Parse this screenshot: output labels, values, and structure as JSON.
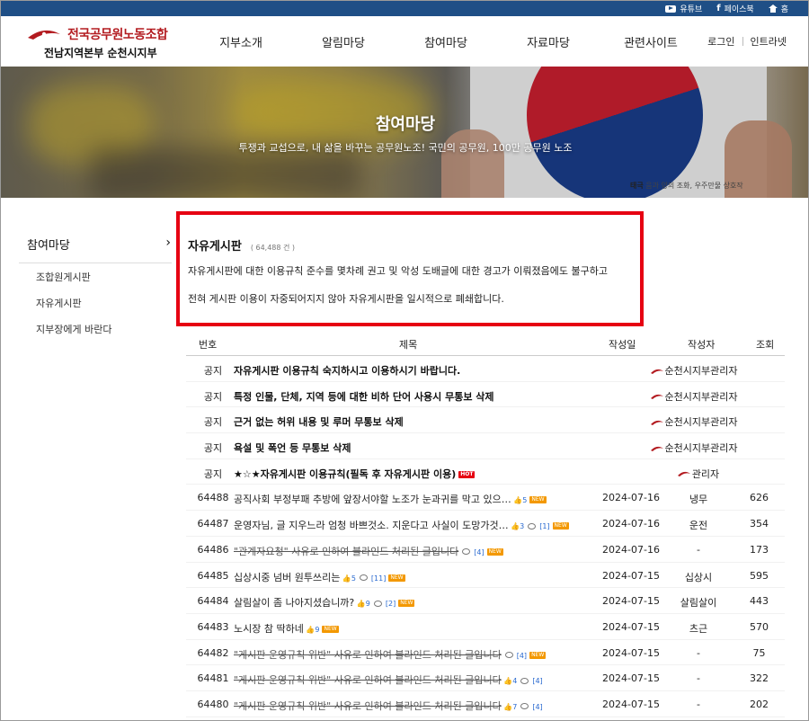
{
  "topbar": {
    "youtube": "유튜브",
    "facebook": "페이스북",
    "home": "홈"
  },
  "header": {
    "org_name": "전국공무원노동조합",
    "branch_name": "전남지역본부 순천시지부",
    "nav": [
      "지부소개",
      "알림마당",
      "참여마당",
      "자료마당",
      "관련사이트"
    ],
    "login": "로그인",
    "intranet": "인트라넷"
  },
  "hero": {
    "title": "참여마당",
    "subtitle": "투쟁과 교섭으로, 내 삶을 바꾸는 공무원노조! 국민의 공무원, 100만 공무원 노조",
    "caption_bold": "태극",
    "caption_rest": " 음과 양의 조화, 우주만물 상호작"
  },
  "sidebar": {
    "heading": "참여마당",
    "items": [
      "조합원게시판",
      "자유게시판",
      "지부장에게 바란다"
    ]
  },
  "notice": {
    "title": "자유게시판",
    "count": "( 64,488 건 )",
    "line1": "자유게시판에 대한 이용규칙 준수를 몇차례 권고 및 악성 도배글에 대한 경고가 이뤄졌음에도 불구하고",
    "line2": "전혀 게시판 이용이 자중되어지지 않아 자유게시판을 일시적으로 폐쇄합니다."
  },
  "board": {
    "headers": {
      "no": "번호",
      "title": "제목",
      "date": "작성일",
      "author": "작성자",
      "views": "조회"
    },
    "notices": [
      {
        "no": "공지",
        "title": "자유게시판 이용규칙 숙지하시고 이용하시기 바랍니다.",
        "author": "순천시지부관리자",
        "views": ""
      },
      {
        "no": "공지",
        "title": "특정 인물, 단체, 지역 등에 대한 비하 단어 사용시 무통보 삭제",
        "author": "순천시지부관리자",
        "views": ""
      },
      {
        "no": "공지",
        "title": "근거 없는 허위 내용 및 루머 무통보 삭제",
        "author": "순천시지부관리자",
        "views": ""
      },
      {
        "no": "공지",
        "title": "욕설 및 폭언 등 무통보 삭제",
        "author": "순천시지부관리자",
        "views": ""
      },
      {
        "no": "공지",
        "title": "★☆★자유게시판 이용규칙(필독 후 자유게시판 이용)",
        "author": "관리자",
        "hot": "HOT",
        "views": ""
      }
    ],
    "posts": [
      {
        "no": "64488",
        "title": "공직사회 부정부패 추방에 앞장서야할 노조가 눈과귀를 막고 있으…",
        "likes": "5",
        "comments": "",
        "new": "NEW",
        "date": "2024-07-16",
        "author": "냉무",
        "views": "626",
        "strike": false
      },
      {
        "no": "64487",
        "title": "운영자님, 글 지우느라 엄청 바쁘것소. 지운다고 사실이 도망가것…",
        "likes": "3",
        "comments": "[1]",
        "new": "NEW",
        "date": "2024-07-16",
        "author": "운전",
        "views": "354",
        "strike": false
      },
      {
        "no": "64486",
        "title": "\"관계자요청\" 사유로 인하여 블라인드 처리된 글입니다",
        "likes": "",
        "comments": "[4]",
        "new": "NEW",
        "date": "2024-07-16",
        "author": "-",
        "views": "173",
        "strike": true
      },
      {
        "no": "64485",
        "title": "십상시중 넘버 원투쓰리는",
        "likes": "5",
        "comments": "[11]",
        "new": "NEW",
        "date": "2024-07-15",
        "author": "십상시",
        "views": "595",
        "strike": false
      },
      {
        "no": "64484",
        "title": "살림살이 좀 나아지셨습니까?",
        "likes": "9",
        "comments": "[2]",
        "new": "NEW",
        "date": "2024-07-15",
        "author": "살림살이",
        "views": "443",
        "strike": false
      },
      {
        "no": "64483",
        "title": "노시장 참 딱하네",
        "likes": "9",
        "comments": "",
        "new": "NEW",
        "date": "2024-07-15",
        "author": "츠근",
        "views": "570",
        "strike": false
      },
      {
        "no": "64482",
        "title": "\"게시판 운영규칙 위반\" 사유로 인하여 블라인드 처리된 글입니다",
        "likes": "",
        "comments": "[4]",
        "new": "NEW",
        "date": "2024-07-15",
        "author": "-",
        "views": "75",
        "strike": true
      },
      {
        "no": "64481",
        "title": "\"게시판 운영규칙 위반\" 사유로 인하여 블라인드 처리된 글입니다",
        "likes": "4",
        "comments": "[4]",
        "new": "",
        "date": "2024-07-15",
        "author": "-",
        "views": "322",
        "strike": true
      },
      {
        "no": "64480",
        "title": "\"게시판 운영규칙 위반\" 사유로 인하여 블라인드 처리된 글입니다",
        "likes": "7",
        "comments": "[4]",
        "new": "",
        "date": "2024-07-15",
        "author": "-",
        "views": "202",
        "strike": true
      }
    ]
  },
  "colors": {
    "topbar": "#1f4f86",
    "notice_border": "#e60012",
    "brand_red": "#b31b20",
    "new_badge": "#f39800"
  }
}
